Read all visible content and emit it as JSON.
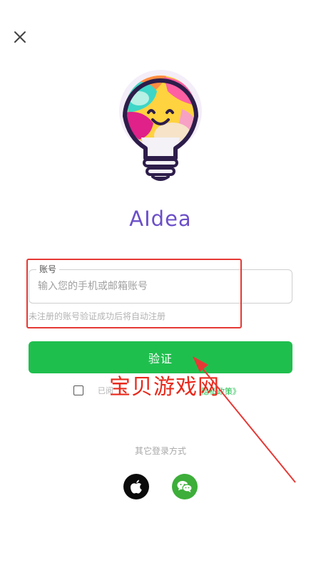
{
  "header": {
    "close_icon": "close-icon"
  },
  "app": {
    "name": "AIdea",
    "logo_icon": "lightbulb-logo"
  },
  "form": {
    "account_label": "账号",
    "account_placeholder": "输入您的手机或邮箱账号",
    "account_value": "",
    "hint": "未注册的账号验证成功后将自动注册",
    "verify_button": "验证"
  },
  "agreement": {
    "checked": false,
    "prefix": "已阅",
    "privacy_link": "隐私政策》"
  },
  "watermark": {
    "text": "宝贝游戏网"
  },
  "other_login": {
    "label": "其它登录方式",
    "methods": [
      {
        "name": "apple",
        "icon": "apple-icon"
      },
      {
        "name": "wechat",
        "icon": "wechat-icon"
      }
    ]
  },
  "colors": {
    "brand_green": "#1fbf4e",
    "title_purple": "#6b4fc8",
    "annotation_red": "#e53935",
    "wechat_green": "#3dae3a"
  }
}
